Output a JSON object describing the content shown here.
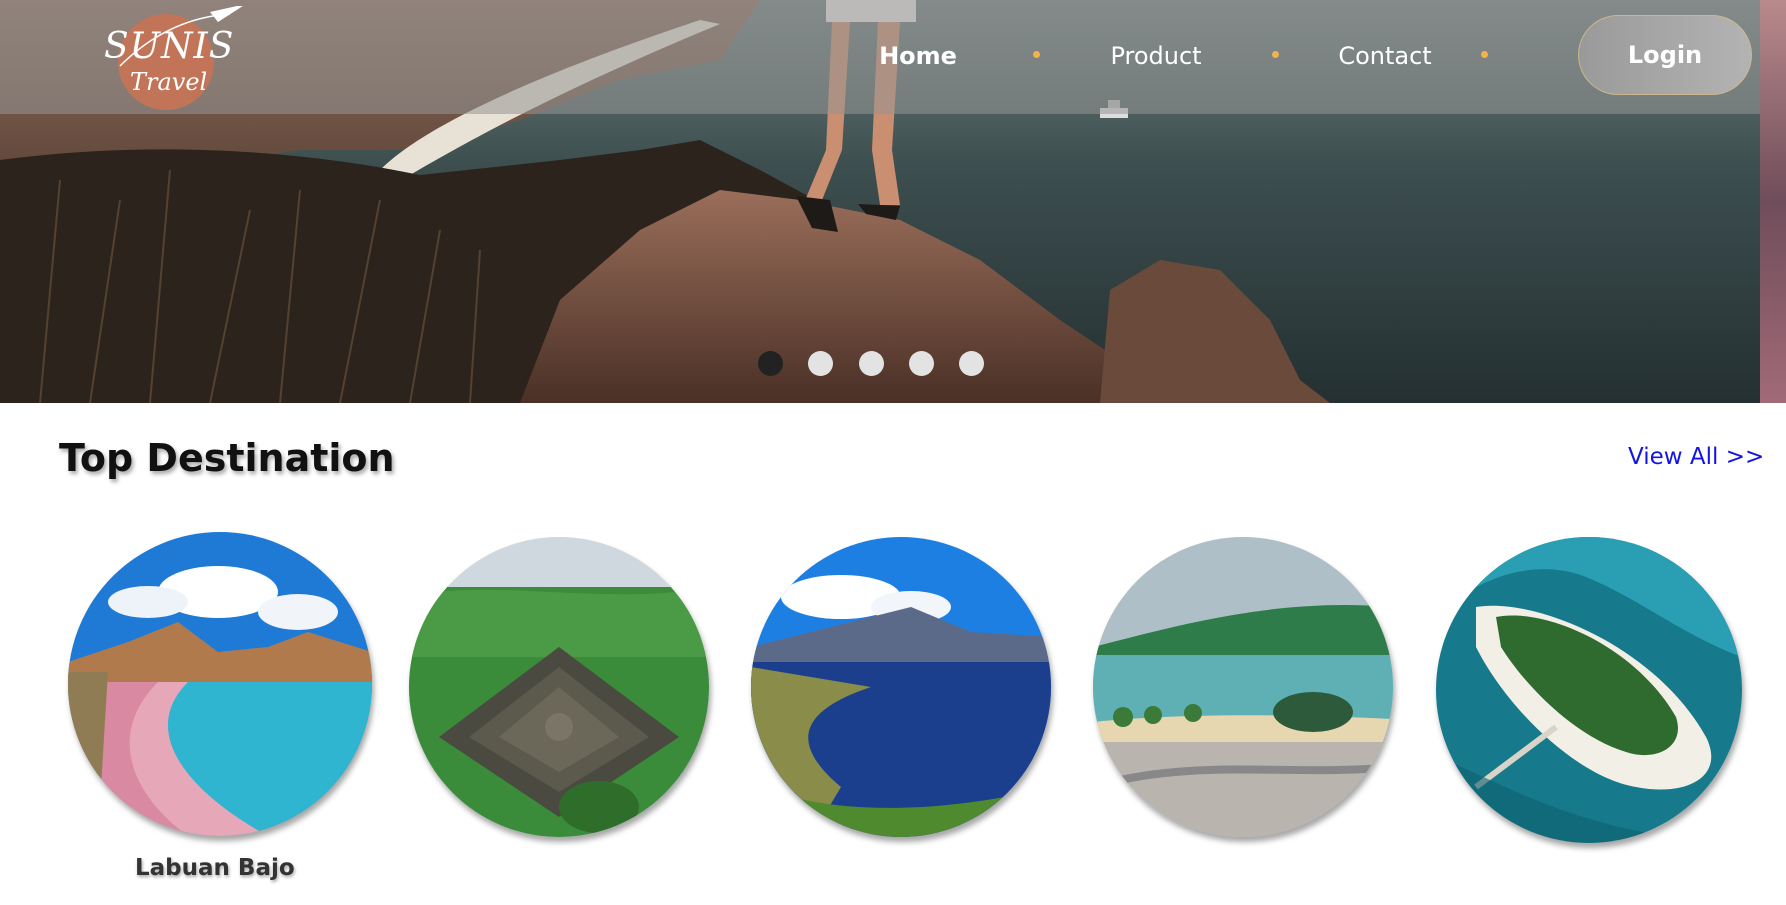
{
  "brand": {
    "logo_text_top": "SUNIS",
    "logo_text_bottom": "Travel",
    "logo_icon": "airplane-icon",
    "logo_color": "#c27458"
  },
  "nav": {
    "items": [
      {
        "label": "Home",
        "active": true
      },
      {
        "label": "Product",
        "active": false
      },
      {
        "label": "Contact",
        "active": false
      }
    ],
    "separator_color": "#f1b44d",
    "login_label": "Login"
  },
  "hero": {
    "slides_total": 5,
    "active_slide": 1
  },
  "top_destination": {
    "title": "Top Destination",
    "view_all_label": "View All >>",
    "destinations": [
      {
        "name": "Labuan Bajo",
        "label_visible": true
      },
      {
        "name": "",
        "label_visible": false
      },
      {
        "name": "",
        "label_visible": false
      },
      {
        "name": "",
        "label_visible": false
      },
      {
        "name": "",
        "label_visible": false
      }
    ]
  },
  "colors": {
    "link": "#1414e6",
    "carousel_active": "#222222",
    "carousel_inactive": "#e3e3e3"
  }
}
